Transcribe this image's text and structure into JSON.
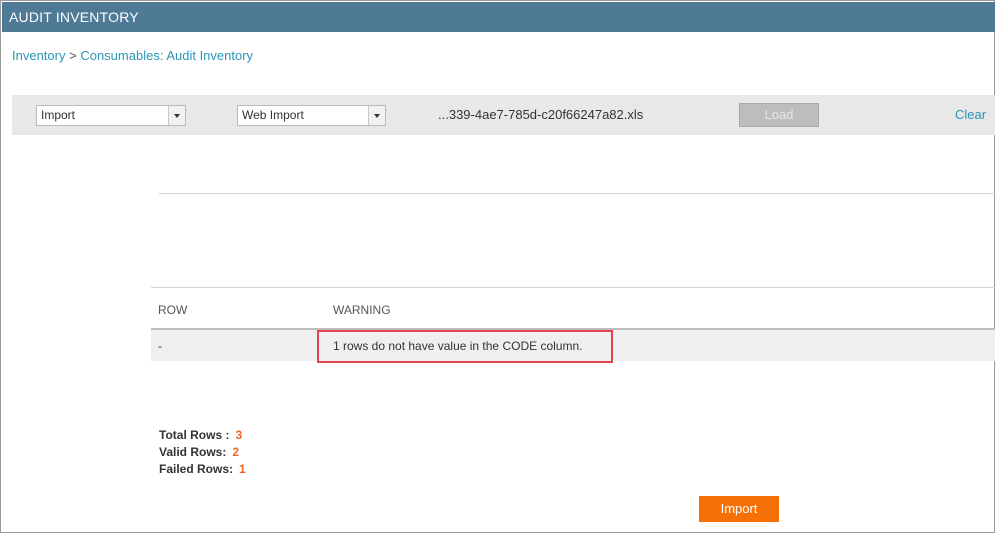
{
  "window": {
    "title": "AUDIT INVENTORY"
  },
  "breadcrumb": {
    "items": [
      "Inventory",
      "Consumables: Audit Inventory"
    ],
    "separator": ">"
  },
  "toolbar": {
    "mode_select": "Import",
    "source_select": "Web Import",
    "filename": "...339-4ae7-785d-c20f66247a82.xls",
    "load_label": "Load",
    "clear_label": "Clear"
  },
  "table": {
    "headers": [
      "ROW",
      "WARNING"
    ],
    "rows": [
      {
        "row": "-",
        "warning": "1 rows do not have value in the CODE column."
      }
    ]
  },
  "summary": {
    "total_label": "Total Rows :",
    "total_value": "3",
    "valid_label": "Valid Rows:",
    "valid_value": "2",
    "failed_label": "Failed Rows:",
    "failed_value": "1"
  },
  "actions": {
    "import_label": "Import"
  },
  "colors": {
    "header_bar": "#4e7a96",
    "link": "#2a96b6",
    "accent": "#f57108",
    "highlight_border": "#e0444f"
  }
}
